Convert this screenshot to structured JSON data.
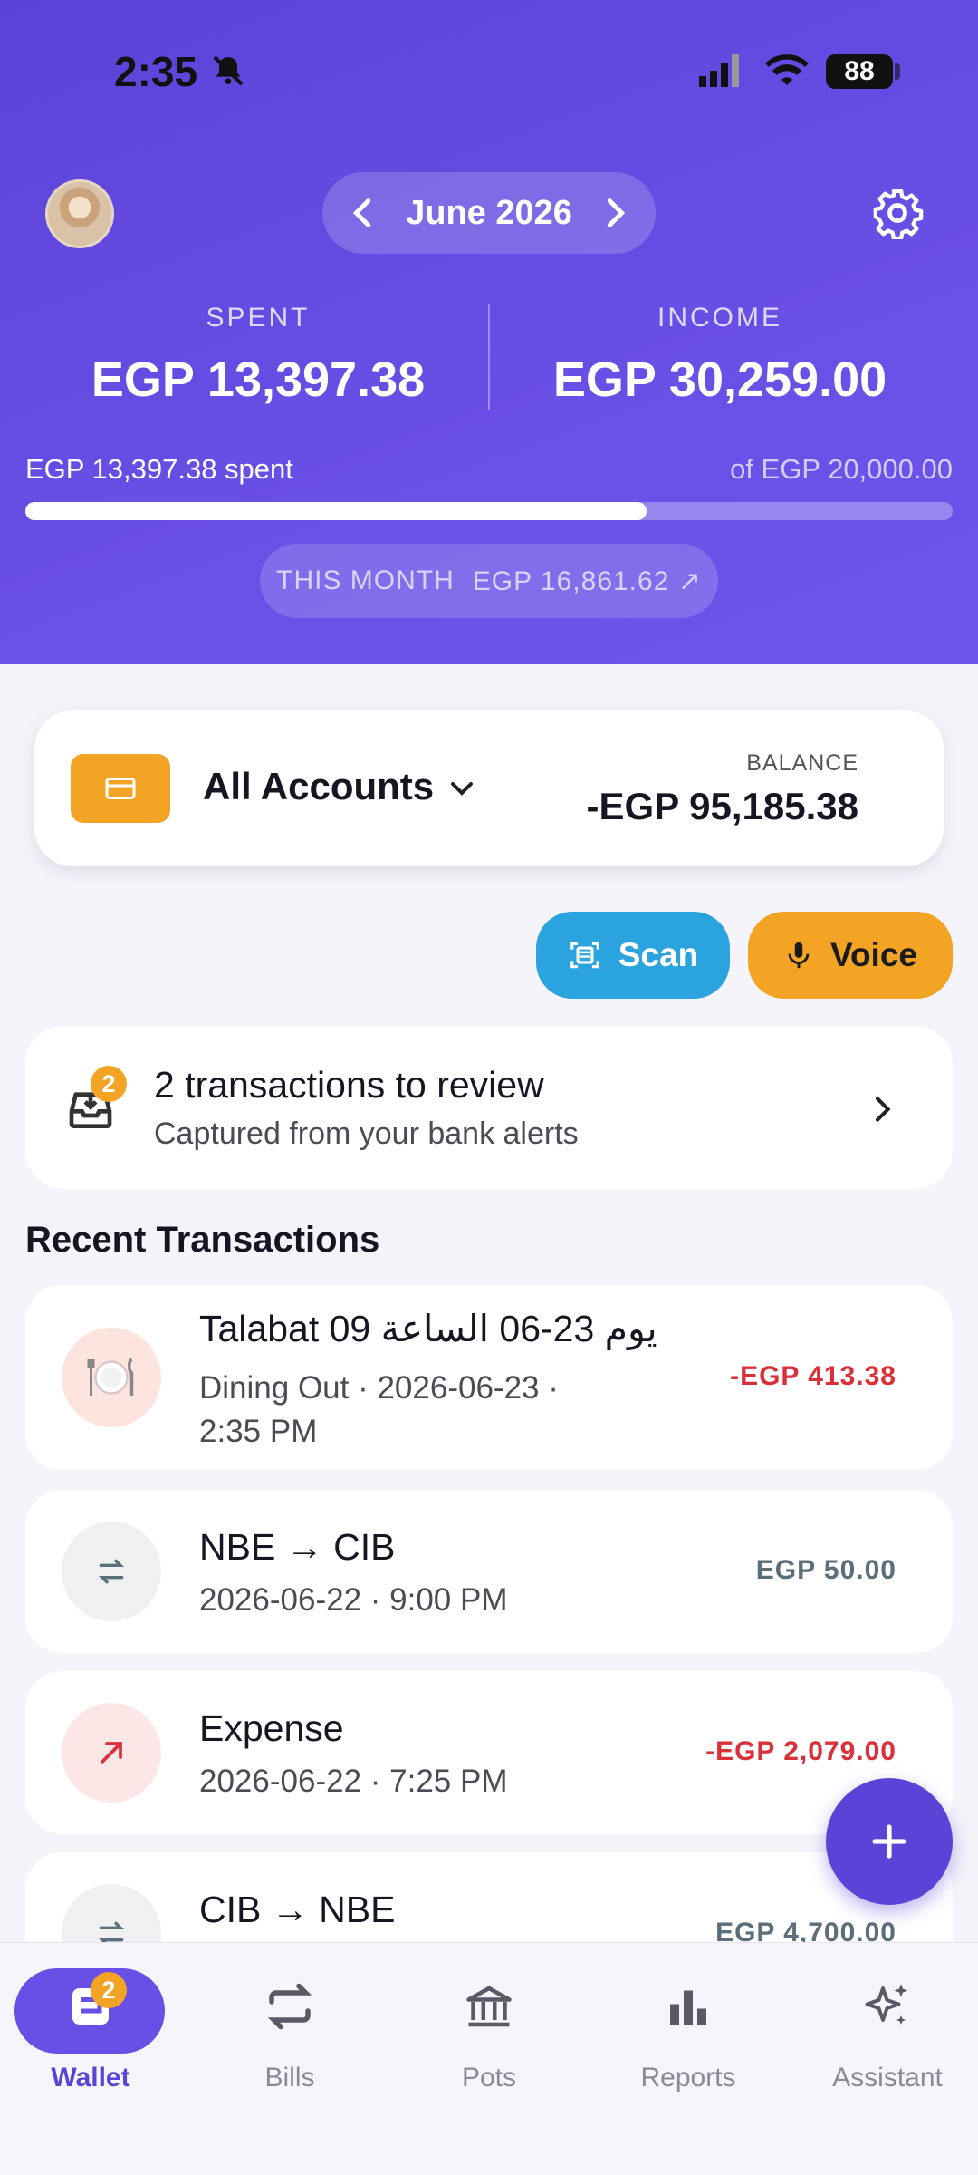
{
  "status": {
    "time": "2:35",
    "battery": "88"
  },
  "header": {
    "month": "June 2026",
    "spent_label": "SPENT",
    "spent_value": "EGP 13,397.38",
    "income_label": "INCOME",
    "income_value": "EGP 30,259.00",
    "budget_spent_text": "EGP 13,397.38 spent",
    "budget_total_text": "of EGP 20,000.00",
    "budget_progress_fraction": 0.67,
    "this_month_label": "THIS MONTH",
    "this_month_value": "EGP 16,861.62 ↗"
  },
  "account": {
    "name": "All Accounts",
    "balance_label": "BALANCE",
    "balance_value": "-EGP 95,185.38"
  },
  "actions": {
    "scan_label": "Scan",
    "voice_label": "Voice"
  },
  "review": {
    "badge": "2",
    "title": "2 transactions to review",
    "subtitle": "Captured from your bank alerts"
  },
  "recent": {
    "title": "Recent Transactions",
    "items": [
      {
        "title": "Talabat 09 يوم 23-06 الساعة",
        "sub1": "Dining Out  ·  2026-06-23  ·",
        "sub2": "2:35 PM",
        "amount": "-EGP 413.38",
        "icon": "dining-icon"
      },
      {
        "title": "NBE → CIB",
        "sub1": "2026-06-22  ·  9:00 PM",
        "amount": "EGP 50.00",
        "icon": "transfer-icon"
      },
      {
        "title": "Expense",
        "sub1": "2026-06-22  ·  7:25 PM",
        "amount": "-EGP 2,079.00",
        "icon": "expense-arrow-icon"
      },
      {
        "title": "CIB → NBE",
        "sub1": "",
        "amount": "EGP 4,700.00",
        "icon": "transfer-icon"
      }
    ]
  },
  "nav": {
    "items": [
      {
        "label": "Wallet",
        "badge": "2",
        "icon": "wallet-icon"
      },
      {
        "label": "Bills",
        "icon": "bills-icon"
      },
      {
        "label": "Pots",
        "icon": "bank-icon"
      },
      {
        "label": "Reports",
        "icon": "bar-chart-icon"
      },
      {
        "label": "Assistant",
        "icon": "sparkle-icon"
      }
    ]
  },
  "colors": {
    "brand": "#5b43d8",
    "accent_orange": "#f4a425",
    "scan_blue": "#2ba3de",
    "negative": "#d9303a"
  }
}
